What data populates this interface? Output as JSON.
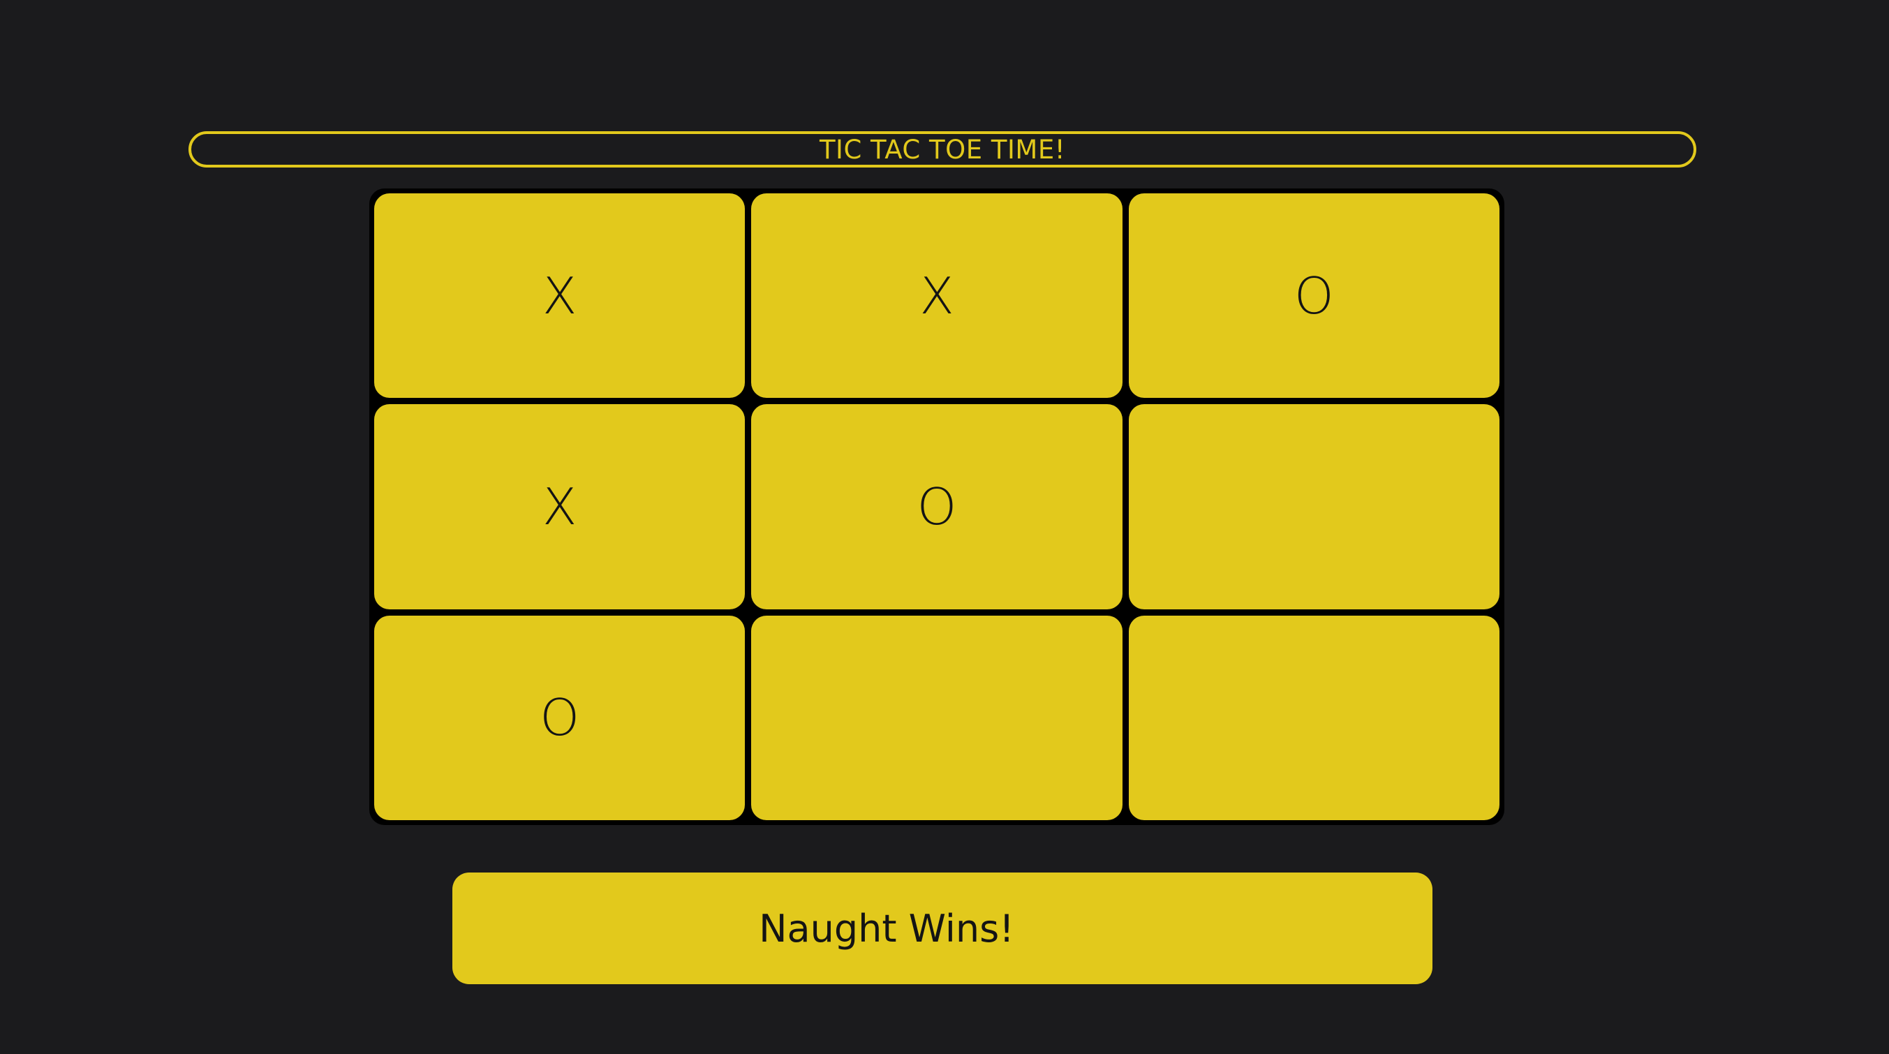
{
  "header": {
    "title": "TIC TAC TOE TIME!"
  },
  "board": {
    "cells": [
      "X",
      "X",
      "O",
      "X",
      "O",
      "",
      "O",
      "",
      ""
    ]
  },
  "status": {
    "message": "Naught Wins!"
  },
  "colors": {
    "background": "#1b1b1d",
    "accent": "#e2c91c",
    "grid": "#000000",
    "mark": "#141414"
  }
}
